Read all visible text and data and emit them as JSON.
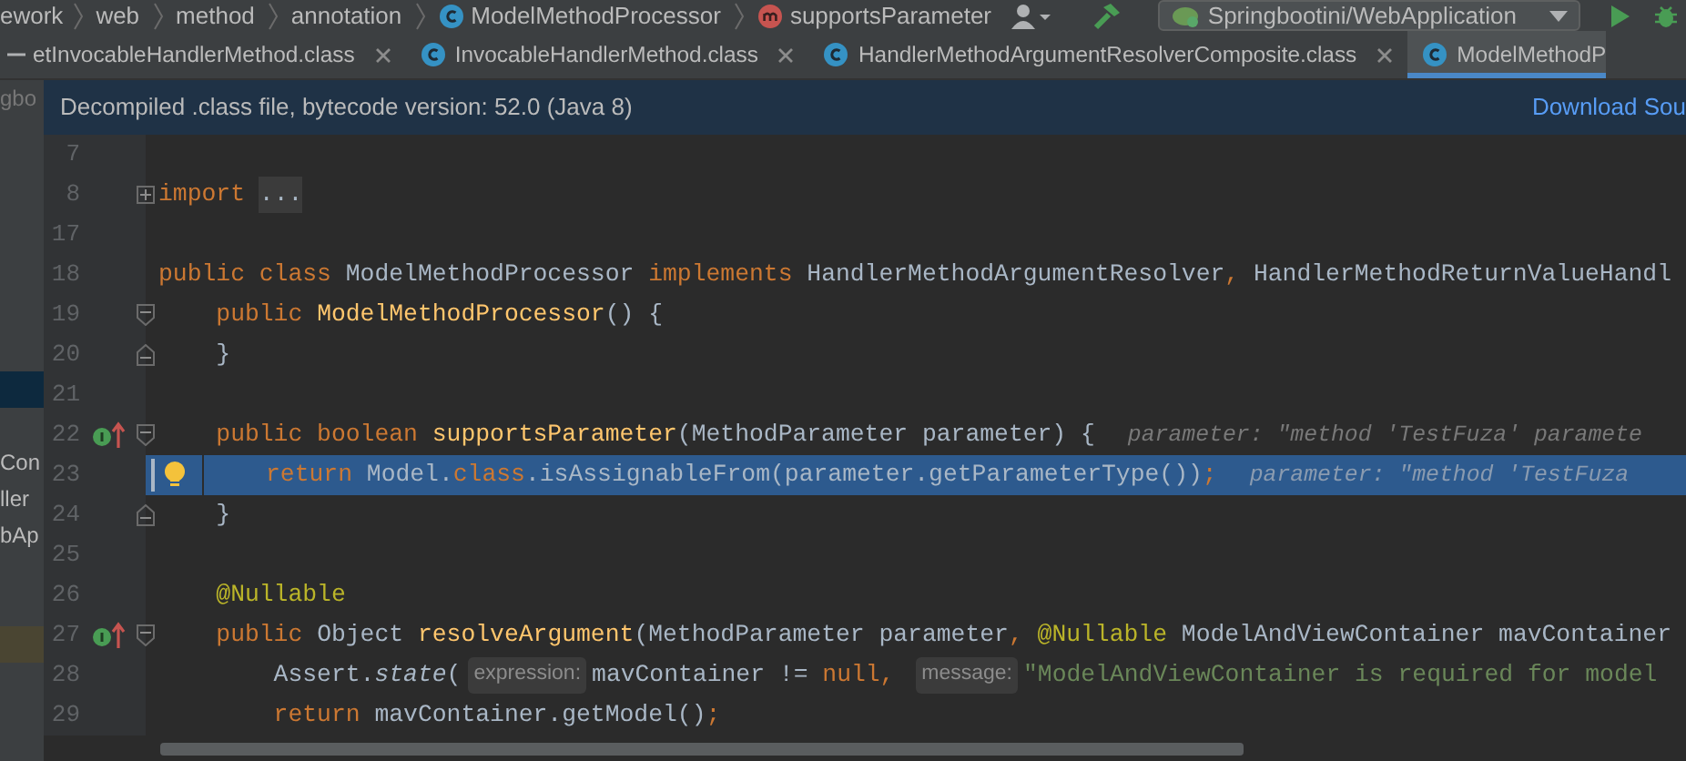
{
  "breadcrumbs": [
    {
      "text": "ework",
      "kind": "folder"
    },
    {
      "text": "web",
      "kind": "folder"
    },
    {
      "text": "method",
      "kind": "folder"
    },
    {
      "text": "annotation",
      "kind": "folder"
    },
    {
      "text": "ModelMethodProcessor",
      "kind": "class"
    },
    {
      "text": "supportsParameter",
      "kind": "method"
    }
  ],
  "run_config": "Springbootini/WebApplication",
  "tabs": [
    {
      "label": "etInvocableHandlerMethod.class",
      "kind": "plain",
      "selected": false
    },
    {
      "label": "InvocableHandlerMethod.class",
      "kind": "class",
      "selected": false
    },
    {
      "label": "HandlerMethodArgumentResolverComposite.class",
      "kind": "class",
      "selected": false
    },
    {
      "label": "ModelMethodP",
      "kind": "class",
      "selected": true
    }
  ],
  "notification": {
    "text": "Decompiled .class file, bytecode version: 52.0 (Java 8)",
    "link": "Download Sou"
  },
  "sidebar": {
    "rows": [
      {
        "kind": "plain",
        "text": "gbo"
      },
      {
        "kind": "blank"
      },
      {
        "kind": "blank"
      },
      {
        "kind": "blank"
      },
      {
        "kind": "blank"
      },
      {
        "kind": "blank"
      },
      {
        "kind": "blank"
      },
      {
        "kind": "blank"
      },
      {
        "kind": "selected"
      },
      {
        "kind": "blank"
      },
      {
        "kind": "plain",
        "text": "Con"
      },
      {
        "kind": "plain",
        "text": "ller"
      },
      {
        "kind": "plain",
        "text": "bAp"
      },
      {
        "kind": "blank"
      },
      {
        "kind": "blank"
      },
      {
        "kind": "found"
      }
    ]
  },
  "code_lines": [
    {
      "number": "7",
      "highlighted": false
    },
    {
      "number": "8",
      "highlighted": false,
      "markers": [
        {
          "kind": "fold-collapsed"
        }
      ],
      "tokens": [
        {
          "kind": "kw",
          "text": "import "
        },
        {
          "kind": "folded",
          "text": "..."
        }
      ]
    },
    {
      "number": "17",
      "highlighted": false
    },
    {
      "number": "18",
      "highlighted": false,
      "tokens": [
        {
          "kind": "kw",
          "text": "public class "
        },
        {
          "kind": "plain",
          "text": "ModelMethodProcessor "
        },
        {
          "kind": "kw",
          "text": "implements "
        },
        {
          "kind": "plain",
          "text": "HandlerMethodArgumentResolver"
        },
        {
          "kind": "kw",
          "text": ", "
        },
        {
          "kind": "plain",
          "text": "HandlerMethodReturnValueHandl"
        }
      ]
    },
    {
      "number": "19",
      "highlighted": false,
      "markers": [
        {
          "kind": "fold-start"
        }
      ],
      "tokens": [
        {
          "kind": "kw",
          "text": "    public "
        },
        {
          "kind": "fn",
          "text": "ModelMethodProcessor"
        },
        {
          "kind": "plain",
          "text": "() {"
        }
      ]
    },
    {
      "number": "20",
      "highlighted": false,
      "markers": [
        {
          "kind": "fold-end"
        }
      ],
      "tokens": [
        {
          "kind": "plain",
          "text": "    }"
        }
      ]
    },
    {
      "number": "21",
      "highlighted": false
    },
    {
      "number": "22",
      "highlighted": false,
      "markers": [
        {
          "kind": "implements"
        },
        {
          "kind": "fold-start"
        }
      ],
      "tokens": [
        {
          "kind": "kw",
          "text": "    public boolean "
        },
        {
          "kind": "fn",
          "text": "supportsParameter"
        },
        {
          "kind": "plain",
          "text": "(MethodParameter parameter) {"
        },
        {
          "kind": "value",
          "text": "parameter: \"method 'TestFuza' paramete"
        }
      ]
    },
    {
      "number": "23",
      "highlighted": true,
      "markers": [
        {
          "kind": "bulb"
        }
      ],
      "tokens": [
        {
          "kind": "kw",
          "text": "return "
        },
        {
          "kind": "plain",
          "text": "Model."
        },
        {
          "kind": "kw",
          "text": "class"
        },
        {
          "kind": "plain",
          "text": ".isAssignableFrom(parameter.getParameterType())"
        },
        {
          "kind": "kw",
          "text": ";"
        },
        {
          "kind": "value",
          "text": "parameter: \"method 'TestFuza"
        }
      ]
    },
    {
      "number": "24",
      "highlighted": false,
      "markers": [
        {
          "kind": "fold-end"
        }
      ],
      "tokens": [
        {
          "kind": "plain",
          "text": "    }"
        }
      ]
    },
    {
      "number": "25",
      "highlighted": false
    },
    {
      "number": "26",
      "highlighted": false,
      "tokens": [
        {
          "kind": "annot",
          "text": "    @Nullable"
        }
      ]
    },
    {
      "number": "27",
      "highlighted": false,
      "markers": [
        {
          "kind": "implements"
        },
        {
          "kind": "fold-start"
        }
      ],
      "tokens": [
        {
          "kind": "kw",
          "text": "    public "
        },
        {
          "kind": "plain",
          "text": "Object "
        },
        {
          "kind": "fn",
          "text": "resolveArgument"
        },
        {
          "kind": "plain",
          "text": "(MethodParameter parameter"
        },
        {
          "kind": "kw",
          "text": ", "
        },
        {
          "kind": "annot",
          "text": "@Nullable "
        },
        {
          "kind": "plain",
          "text": "ModelAndViewContainer mavContainer"
        }
      ]
    },
    {
      "number": "28",
      "highlighted": false,
      "tokens": [
        {
          "kind": "plain",
          "text": "        Assert."
        },
        {
          "kind": "italic",
          "text": "state"
        },
        {
          "kind": "plain",
          "text": "("
        },
        {
          "kind": "hint",
          "text": "expression:"
        },
        {
          "kind": "plain",
          "text": "mavContainer != "
        },
        {
          "kind": "kw",
          "text": "null, "
        },
        {
          "kind": "hint",
          "text": "message:"
        },
        {
          "kind": "str",
          "text": "\"ModelAndViewContainer is required for model"
        }
      ]
    },
    {
      "number": "29",
      "highlighted": false,
      "tokens": [
        {
          "kind": "kw",
          "text": "        return "
        },
        {
          "kind": "plain",
          "text": "mavContainer.getModel()"
        },
        {
          "kind": "kw",
          "text": ";"
        }
      ]
    }
  ]
}
